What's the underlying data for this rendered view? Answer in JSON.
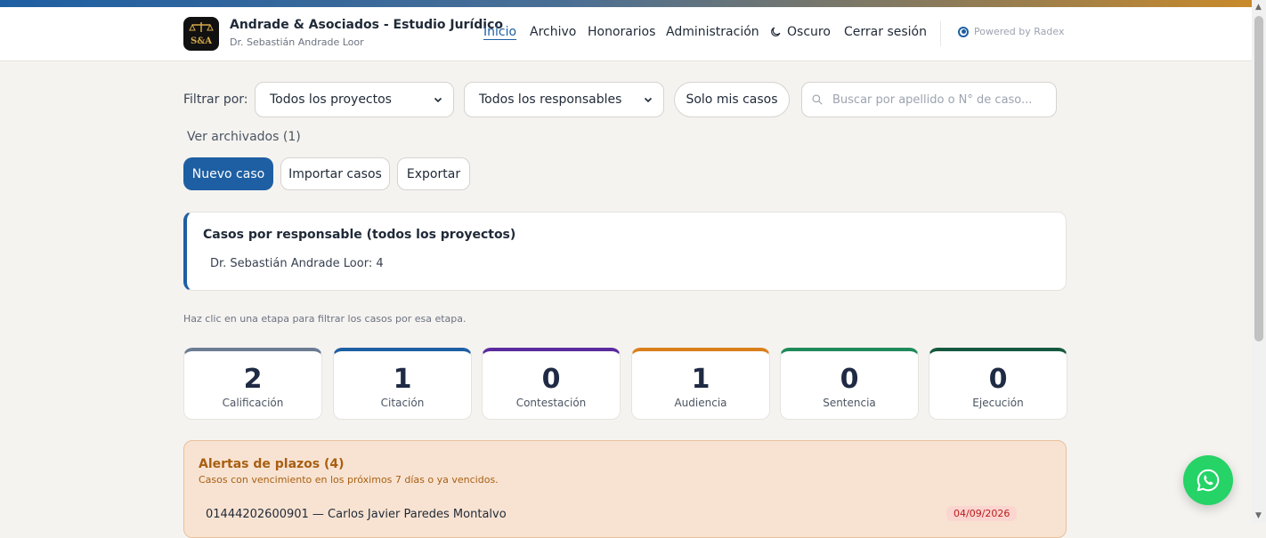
{
  "header": {
    "brand_name": "Andrade & Asociados - Estudio Jurídico",
    "brand_sub": "Dr. Sebastián Andrade Loor",
    "logo_text": "S&A",
    "nav": [
      {
        "label": "Inicio",
        "active": true
      },
      {
        "label": "Archivo"
      },
      {
        "label": "Honorarios"
      },
      {
        "label": "Administración"
      },
      {
        "label": "Oscuro"
      },
      {
        "label": "Cerrar sesión"
      }
    ],
    "powered": "Powered by Radex"
  },
  "filters": {
    "label": "Filtrar por:",
    "project_select": "Todos los proyectos",
    "owner_select": "Todos los responsables",
    "my_cases": "Solo mis casos",
    "search_placeholder": "Buscar por apellido o N° de caso..."
  },
  "archived_link": "Ver archivados (1)",
  "actions": {
    "new_case": "Nuevo caso",
    "import": "Importar casos",
    "export": "Exportar"
  },
  "responsables": {
    "title": "Casos por responsable (todos los proyectos)",
    "line": "Dr. Sebastián Andrade Loor: 4"
  },
  "stage_hint": "Haz clic en una etapa para filtrar los casos por esa etapa.",
  "stages": [
    {
      "count": "2",
      "label": "Calificación",
      "color": "#6b7c93"
    },
    {
      "count": "1",
      "label": "Citación",
      "color": "#1e5fa3"
    },
    {
      "count": "0",
      "label": "Contestación",
      "color": "#5b2a9e"
    },
    {
      "count": "1",
      "label": "Audiencia",
      "color": "#d9801c"
    },
    {
      "count": "0",
      "label": "Sentencia",
      "color": "#1f8a5a"
    },
    {
      "count": "0",
      "label": "Ejecución",
      "color": "#14593f"
    }
  ],
  "alerts": {
    "title": "Alertas de plazos (4)",
    "subtitle": "Casos con vencimiento en los próximos 7 días o ya vencidos.",
    "first_row": "01444202600901 — Carlos Javier Paredes Montalvo",
    "first_date": "04/09/2026"
  },
  "colors": {
    "accent": "#1e5fa3",
    "whatsapp": "#25d366"
  }
}
